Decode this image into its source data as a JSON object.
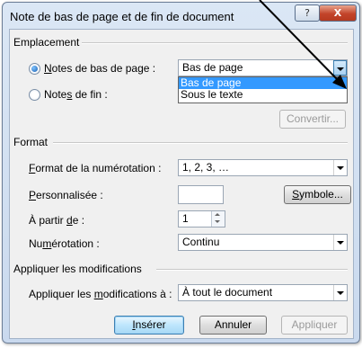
{
  "window": {
    "title": "Note de bas de page et de fin de document",
    "help_label": "?",
    "close_label": "X"
  },
  "emplacement": {
    "heading": "Emplacement",
    "notes_bas": {
      "pre": "",
      "accel": "N",
      "post": "otes de bas de page :",
      "selected": true
    },
    "notes_fin": {
      "pre": "Note",
      "accel": "s",
      "post": " de fin :",
      "selected": false
    },
    "position_value": "Bas de page",
    "position_options": [
      "Bas de page",
      "Sous le texte"
    ],
    "position_highlighted_index": 0,
    "convertir_label": "Convertir..."
  },
  "format": {
    "heading": "Format",
    "numerotation_format": {
      "pre": "",
      "accel": "F",
      "post": "ormat de la numérotation :",
      "value": "1, 2, 3, …"
    },
    "personnalisee": {
      "pre": "",
      "accel": "P",
      "post": "ersonnalisée :",
      "value": ""
    },
    "symbole": {
      "pre": "",
      "accel": "S",
      "post": "ymbole..."
    },
    "a_partir_de": {
      "pre": "À partir ",
      "accel": "d",
      "post": "e :",
      "value": "1"
    },
    "numerotation": {
      "pre": "Nu",
      "accel": "m",
      "post": "érotation :",
      "value": "Continu"
    }
  },
  "appliquer": {
    "heading": "Appliquer les modifications",
    "label": {
      "pre": "Appliquer les ",
      "accel": "m",
      "post": "odifications à :"
    },
    "value": "À tout le document"
  },
  "buttons": {
    "inserer": {
      "pre": "",
      "accel": "I",
      "post": "nsérer"
    },
    "annuler": "Annuler",
    "appliquer": "Appliquer"
  },
  "colors": {
    "selection": "#3399ff",
    "dialog_bg": "#f0f0f0",
    "title_bar": "#c9d9ee",
    "close_red": "#c3442a"
  }
}
